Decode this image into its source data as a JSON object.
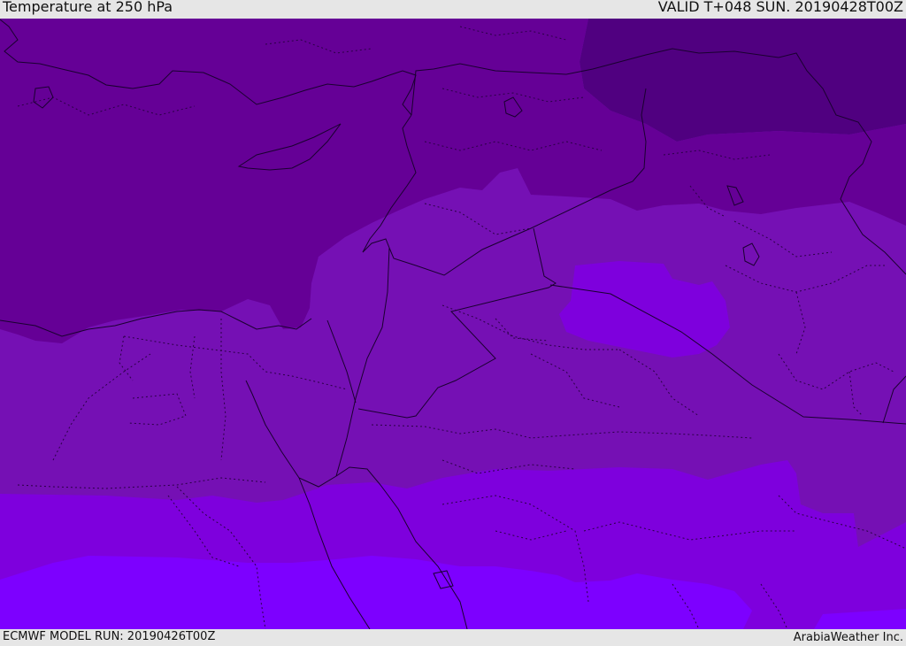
{
  "header": {
    "title": "Temperature at 250 hPa",
    "valid": "VALID T+048 SUN. 20190428T00Z"
  },
  "footer": {
    "model_run": "ECMWF MODEL RUN: 20190426T00Z",
    "credit": "ArabiaWeather Inc."
  },
  "colors": {
    "band_coldest": "#500080",
    "band_cold": "#650096",
    "band_mid": "#7510b4",
    "band_warm": "#7e00dd",
    "band_warmest": "#7d00ff",
    "border_line": "#1a0030",
    "bar_background": "#e6e6e6"
  }
}
